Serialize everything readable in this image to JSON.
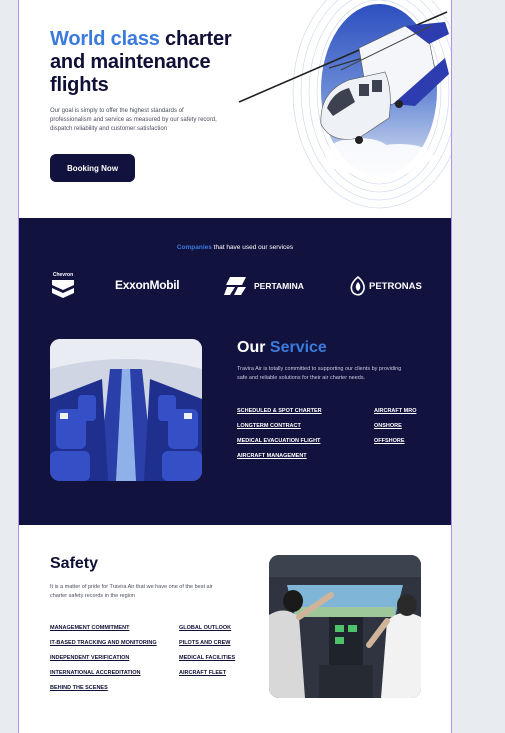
{
  "hero": {
    "title_accent": "World class",
    "title_rest": " charter and maintenance flights",
    "description": "Our goal is simply to offer the highest standards of professionalism and service as measured by our safety record, dispatch reliability and customer satisfaction",
    "booking_label": "Booking Now"
  },
  "companies": {
    "highlight": "Companies",
    "rest": " that have used our services",
    "logos": [
      {
        "name": "Chevron",
        "icon": "chevron-logo"
      },
      {
        "name": "ExxonMobil",
        "icon": "exxonmobil-logo"
      },
      {
        "name": "PERTAMINA",
        "icon": "pertamina-logo"
      },
      {
        "name": "PETRONAS",
        "icon": "petronas-logo"
      }
    ]
  },
  "service": {
    "title_plain": "Our ",
    "title_accent": "Service",
    "description": "Travira Air is totally committed to supporting our clients by providing safe and reliable solutions for their air charter needs.",
    "links_left": [
      "SCHEDULED & SPOT CHARTER",
      "LONGTERM CONTRACT",
      "MEDICAL EVACUATION FLIGHT",
      "AIRCRAFT MANAGEMENT"
    ],
    "links_right": [
      "AIRCRAFT MRO",
      "ONSHORE",
      "OFFSHORE"
    ]
  },
  "safety": {
    "title": "Safety",
    "description": "It is a matter of pride for Travira Air that we have one of the best air charter safety records in the region",
    "links_left": [
      "MANAGEMENT COMMITMENT",
      "IT-BASED TRACKING AND MONITORING",
      "INDEPENDENT VERIFICATION",
      "INTERNATIONAL ACCREDITATION",
      "BEHIND THE SCENES"
    ],
    "links_right": [
      "GLOBAL OUTLOOK",
      "PILOTS AND CREW",
      "MEDICAL FACILITIES",
      "AIRCRAFT FLEET"
    ]
  },
  "colors": {
    "navy": "#12123f",
    "accent": "#3a7bdc",
    "frame": "#b58cf0"
  }
}
